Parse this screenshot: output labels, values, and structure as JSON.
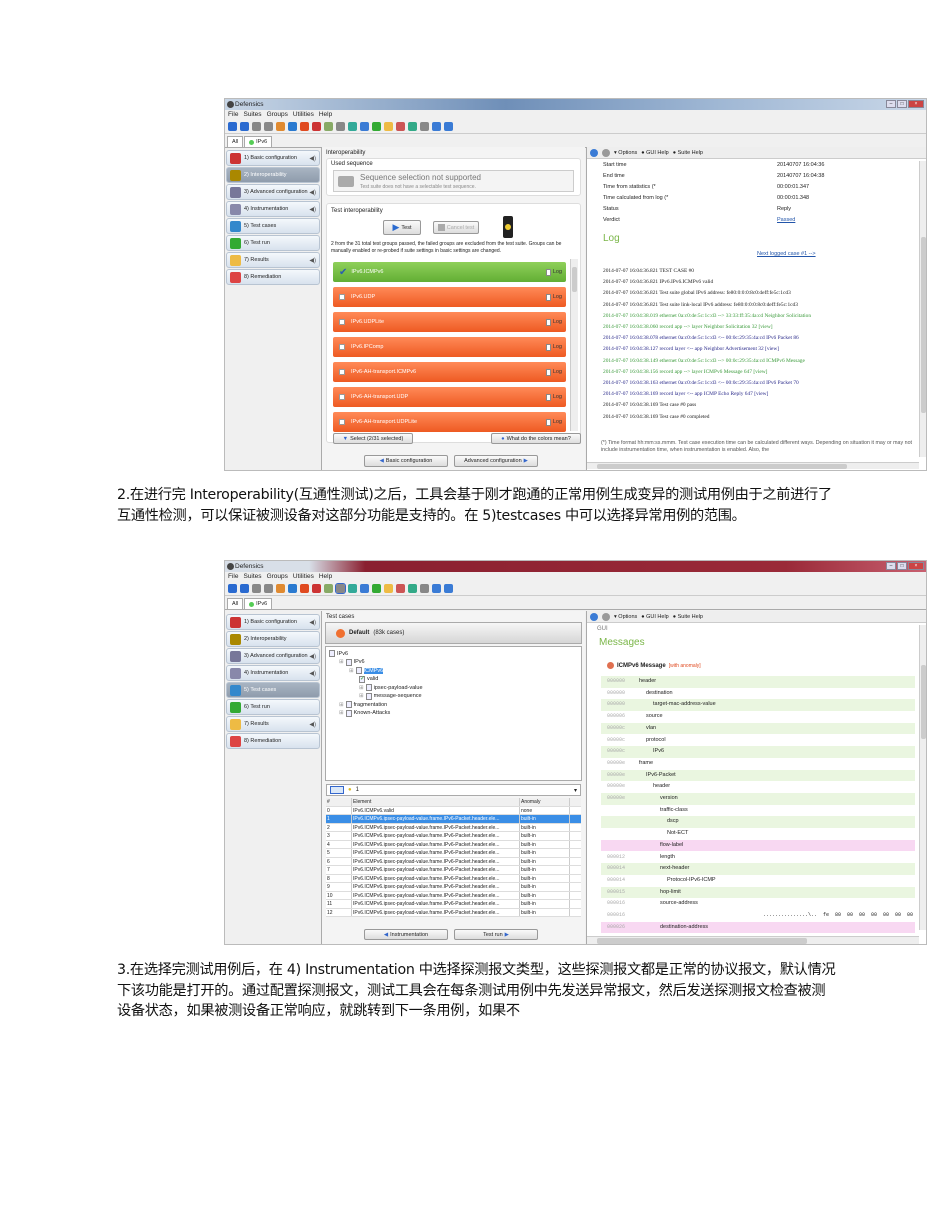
{
  "app": {
    "title": "Defensics",
    "menu": [
      "File",
      "Suites",
      "Groups",
      "Utilities",
      "Help"
    ],
    "tabs": [
      "All",
      "IPv6"
    ],
    "sidebar": [
      "1) Basic configuration",
      "2) Interoperability",
      "3) Advanced configuration",
      "4) Instrumentation",
      "5) Test cases",
      "6) Test run",
      "7) Results",
      "8) Remediation"
    ],
    "right_toolbar": {
      "options": "Options",
      "gui_help": "GUI Help",
      "suite_help": "Suite Help"
    }
  },
  "shot1": {
    "section_title": "Interoperability",
    "used_sequence": {
      "label": "Used sequence",
      "title": "Sequence selection not supported",
      "subtitle": "Test suite does not have a selectable test sequence."
    },
    "test_interop": {
      "label": "Test interoperability",
      "test_button": "Test",
      "cancel_button": "Cancel test",
      "note": "2 from the 31 total test groups passed, the failed groups are excluded from the test suite. Groups can be manually enabled or re-probed if suite settings in basic settings are changed.",
      "groups": [
        {
          "name": "IPv6.ICMPv6",
          "status": "pass"
        },
        {
          "name": "IPv6.UDP",
          "status": "fail"
        },
        {
          "name": "IPv6.UDPLite",
          "status": "fail"
        },
        {
          "name": "IPv6.IPComp",
          "status": "fail"
        },
        {
          "name": "IPv6-AH-transport.ICMPv6",
          "status": "fail"
        },
        {
          "name": "IPv6-AH-transport.UDP",
          "status": "fail"
        },
        {
          "name": "IPv6-AH-transport.UDPLite",
          "status": "fail"
        }
      ],
      "log_label": "Log",
      "select_button": "Select (2/31 selected)",
      "colors_button": "What do the colors mean?"
    },
    "nav": {
      "back": "Basic configuration",
      "next": "Advanced configuration"
    },
    "details": [
      {
        "k": "Start time",
        "v": "20140707 16:04:36"
      },
      {
        "k": "End time",
        "v": "20140707 16:04:38"
      },
      {
        "k": "Time from statistics (*",
        "v": "00:00:01.347"
      },
      {
        "k": "Time calculated from log (*",
        "v": "00:00:01.348"
      },
      {
        "k": "Status",
        "v": "Reply"
      },
      {
        "k": "Verdict",
        "v": "Passed"
      }
    ],
    "log_title": "Log",
    "next_logged": "Next logged case #1 -->",
    "log_lines": [
      {
        "t": "2014-07-07 16:04:36.821 TEST CASE #0",
        "c": "#222"
      },
      {
        "t": "2014-07-07 16:04:36.821 IPv6.IPv6.ICMPv6 valid",
        "c": "#222"
      },
      {
        "t": "2014-07-07 16:04:36.821 Test suite global IPv6 address: fe80:0:0:0:8c0:deff:fe5c:1cd3",
        "c": "#222"
      },
      {
        "t": "2014-07-07 16:04:36.821 Test suite link-local IPv6 address: fe80:0:0:0:8c0:deff:fe5c:1cd3",
        "c": "#222"
      },
      {
        "t": "2014-07-07 16:04:38.019 ethernet 0a:c0:de:5c:1c:d3 --> 33:33:ff:35:4a:cd Neighbor Solicitation",
        "c": "#3a9a3a"
      },
      {
        "t": "2014-07-07 16:04:38.060 record app --> layer Neighbor Solicitation 32 [view]",
        "c": "#3a9a3a"
      },
      {
        "t": "2014-07-07 16:04:38.078 ethernet 0a:c0:de:5c:1c:d3 <-- 00:0c:29:35:4a:cd IPv6 Packet 86",
        "c": "#2a2a8a"
      },
      {
        "t": "2014-07-07 16:04:38.127 record layer <-- app Neighbor Advertisement 32 [view]",
        "c": "#2a2a8a"
      },
      {
        "t": "2014-07-07 16:04:38.149 ethernet 0a:c0:de:5c:1c:d3 --> 00:0c:29:35:4a:cd ICMPv6 Message",
        "c": "#3a9a3a"
      },
      {
        "t": "2014-07-07 16:04:38.156 record app --> layer ICMPv6 Message 647 [view]",
        "c": "#3a9a3a"
      },
      {
        "t": "2014-07-07 16:04:38.163 ethernet 0a:c0:de:5c:1c:d3 <-- 00:0c:29:35:4a:cd IPv6 Packet 70",
        "c": "#2a2a8a"
      },
      {
        "t": "2014-07-07 16:04:38.169 record layer <-- app ICMP Echo Reply 647 [view]",
        "c": "#2a2a8a"
      },
      {
        "t": "2014-07-07 16:04:38.169 Test case #0 pass",
        "c": "#222"
      },
      {
        "t": "2014-07-07 16:04:38.169 Test case #0 completed",
        "c": "#222"
      }
    ],
    "footnote": "(*) Time format hh:mm:ss.mmm. Test case execution time can be calculated different ways. Depending on situation it may or may not include instrumentation time, when instrumentation is enabled. Also, the"
  },
  "para1": "2.在进行完 Interoperability(互通性测试)之后，工具会基于刚才跑通的正常用例生成变异的测试用例由于之前进行了互通性检测，可以保证被测设备对这部分功能是支持的。在 5)testcases 中可以选择异常用例的范围。",
  "shot2": {
    "section_title": "Test cases",
    "profile": "Default",
    "profile_count": "(83k cases)",
    "tree": [
      {
        "label": "IPv6",
        "depth": 0
      },
      {
        "label": "IPv6",
        "depth": 1
      },
      {
        "label": "ICMPv6",
        "depth": 2,
        "selected": true
      },
      {
        "label": "valid",
        "depth": 3,
        "check": true
      },
      {
        "label": "ipsec-payload-value",
        "depth": 3
      },
      {
        "label": "message-sequence",
        "depth": 3
      },
      {
        "label": "fragmentation",
        "depth": 1
      },
      {
        "label": "Known-Attacks",
        "depth": 1
      }
    ],
    "filter_value": "1",
    "table_headers": [
      "#",
      "Element",
      "Anomaly"
    ],
    "rows": [
      [
        "0",
        "IPv6.ICMPv6.valid",
        "none"
      ],
      [
        "1",
        "IPv6.ICMPv6.ipsec-payload-value.frame.IPv6-Packet.header.ele...",
        "built-in"
      ],
      [
        "2",
        "IPv6.ICMPv6.ipsec-payload-value.frame.IPv6-Packet.header.ele...",
        "built-in"
      ],
      [
        "3",
        "IPv6.ICMPv6.ipsec-payload-value.frame.IPv6-Packet.header.ele...",
        "built-in"
      ],
      [
        "4",
        "IPv6.ICMPv6.ipsec-payload-value.frame.IPv6-Packet.header.ele...",
        "built-in"
      ],
      [
        "5",
        "IPv6.ICMPv6.ipsec-payload-value.frame.IPv6-Packet.header.ele...",
        "built-in"
      ],
      [
        "6",
        "IPv6.ICMPv6.ipsec-payload-value.frame.IPv6-Packet.header.ele...",
        "built-in"
      ],
      [
        "7",
        "IPv6.ICMPv6.ipsec-payload-value.frame.IPv6-Packet.header.ele...",
        "built-in"
      ],
      [
        "8",
        "IPv6.ICMPv6.ipsec-payload-value.frame.IPv6-Packet.header.ele...",
        "built-in"
      ],
      [
        "9",
        "IPv6.ICMPv6.ipsec-payload-value.frame.IPv6-Packet.header.ele...",
        "built-in"
      ],
      [
        "10",
        "IPv6.ICMPv6.ipsec-payload-value.frame.IPv6-Packet.header.ele...",
        "built-in"
      ],
      [
        "11",
        "IPv6.ICMPv6.ipsec-payload-value.frame.IPv6-Packet.header.ele...",
        "built-in"
      ],
      [
        "12",
        "IPv6.ICMPv6.ipsec-payload-value.frame.IPv6-Packet.header.ele...",
        "built-in"
      ]
    ],
    "nav": {
      "back": "Instrumentation",
      "next": "Test run"
    },
    "gui_label": "GUI",
    "messages_title": "Messages",
    "message_name": "ICMPv6 Message",
    "message_tag": "[with anomaly]",
    "fields": [
      {
        "off": "000000",
        "name": "header",
        "d": 0,
        "bg": "g"
      },
      {
        "off": "000000",
        "name": "destination",
        "d": 1,
        "bg": ""
      },
      {
        "off": "000000",
        "name": "target-mac-address-value",
        "d": 2,
        "bg": "g"
      },
      {
        "off": "000006",
        "name": "source",
        "d": 1,
        "bg": ""
      },
      {
        "off": "00000c",
        "name": "vlan",
        "d": 1,
        "bg": "g"
      },
      {
        "off": "00000c",
        "name": "protocol",
        "d": 1,
        "bg": ""
      },
      {
        "off": "00000c",
        "name": "IPv6",
        "d": 2,
        "bg": "g"
      },
      {
        "off": "00000e",
        "name": "frame",
        "d": 0,
        "bg": ""
      },
      {
        "off": "00000e",
        "name": "IPv6-Packet",
        "d": 1,
        "bg": "g"
      },
      {
        "off": "00000e",
        "name": "header",
        "d": 2,
        "bg": ""
      },
      {
        "off": "00000e",
        "name": "version",
        "d": 3,
        "bg": "g"
      },
      {
        "off": "",
        "name": "traffic-class",
        "d": 3,
        "bg": ""
      },
      {
        "off": "",
        "name": "dscp",
        "d": 4,
        "bg": "g"
      },
      {
        "off": "",
        "name": "Not-ECT",
        "d": 4,
        "bg": ""
      },
      {
        "off": "",
        "name": "flow-label",
        "d": 3,
        "bg": "p"
      },
      {
        "off": "000012",
        "name": "length",
        "d": 3,
        "bg": ""
      },
      {
        "off": "000014",
        "name": "next-header",
        "d": 3,
        "bg": "g"
      },
      {
        "off": "000014",
        "name": "Protocol-IPv6-ICMP",
        "d": 4,
        "bg": ""
      },
      {
        "off": "000015",
        "name": "hop-limit",
        "d": 3,
        "bg": "g"
      },
      {
        "off": "000016",
        "name": "source-address",
        "d": 3,
        "bg": ""
      },
      {
        "off": "000016",
        "name": "",
        "d": 3,
        "bg": "",
        "hex": "...............\\..  fe  80  00  00  00  00  00  00"
      },
      {
        "off": "000026",
        "name": "destination-address",
        "d": 3,
        "bg": "p"
      }
    ]
  },
  "para2": "3.在选择完测试用例后，在 4) Instrumentation 中选择探测报文类型，这些探测报文都是正常的协议报文，默认情况下该功能是打开的。通过配置探测报文，测试工具会在每条测试用例中先发送异常报文，然后发送探测报文检查被测设备状态，如果被测设备正常响应，就跳转到下一条用例，如果不",
  "colors": {
    "pass": "#6ab83c",
    "fail": "#f06a30",
    "log_title": "#7ab648",
    "link": "#2255aa",
    "anomaly": "#e04a20"
  }
}
